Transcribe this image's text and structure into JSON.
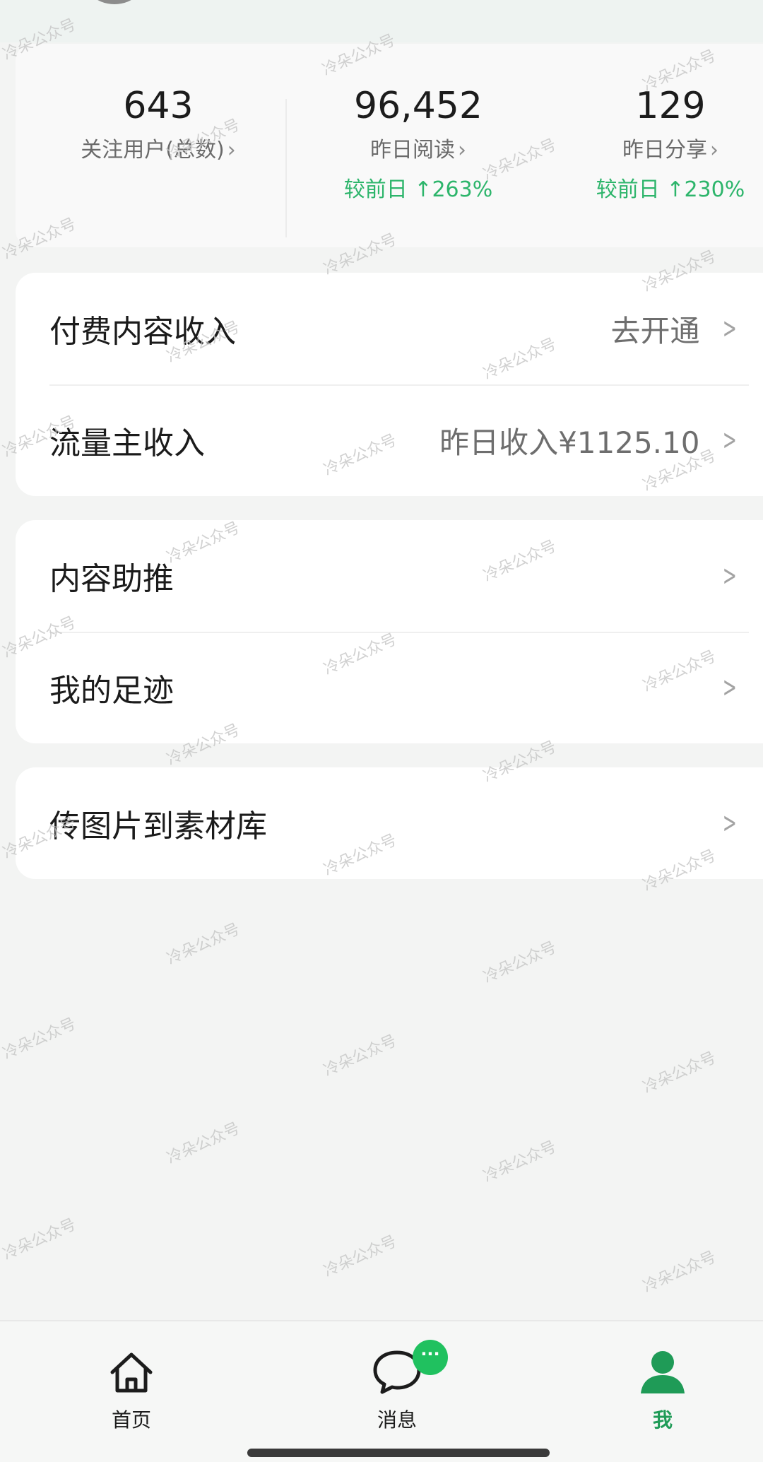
{
  "stats": [
    {
      "value": "643",
      "label": "关注用户(总数)",
      "change": ""
    },
    {
      "value": "96,452",
      "label": "昨日阅读",
      "change": "较前日 ↑263%"
    },
    {
      "value": "129",
      "label": "昨日分享",
      "change": "较前日 ↑230%"
    }
  ],
  "income_card": {
    "items": [
      {
        "title": "付费内容收入",
        "value": "去开通"
      },
      {
        "title": "流量主收入",
        "value": "昨日收入¥1125.10"
      }
    ]
  },
  "tools_card": {
    "items": [
      {
        "title": "内容助推"
      },
      {
        "title": "我的足迹"
      }
    ]
  },
  "upload_card": {
    "items": [
      {
        "title": "传图片到素材库"
      }
    ]
  },
  "bottom_nav": {
    "items": [
      {
        "label": "首页",
        "icon": "home-icon"
      },
      {
        "label": "消息",
        "icon": "message-icon",
        "badge": "···"
      },
      {
        "label": "我",
        "icon": "user-icon",
        "active": true
      }
    ]
  },
  "watermark": "冷朵公众号",
  "colors": {
    "accent_green": "#2db56b",
    "badge_green": "#20c15f",
    "active_nav": "#1f9b57"
  }
}
